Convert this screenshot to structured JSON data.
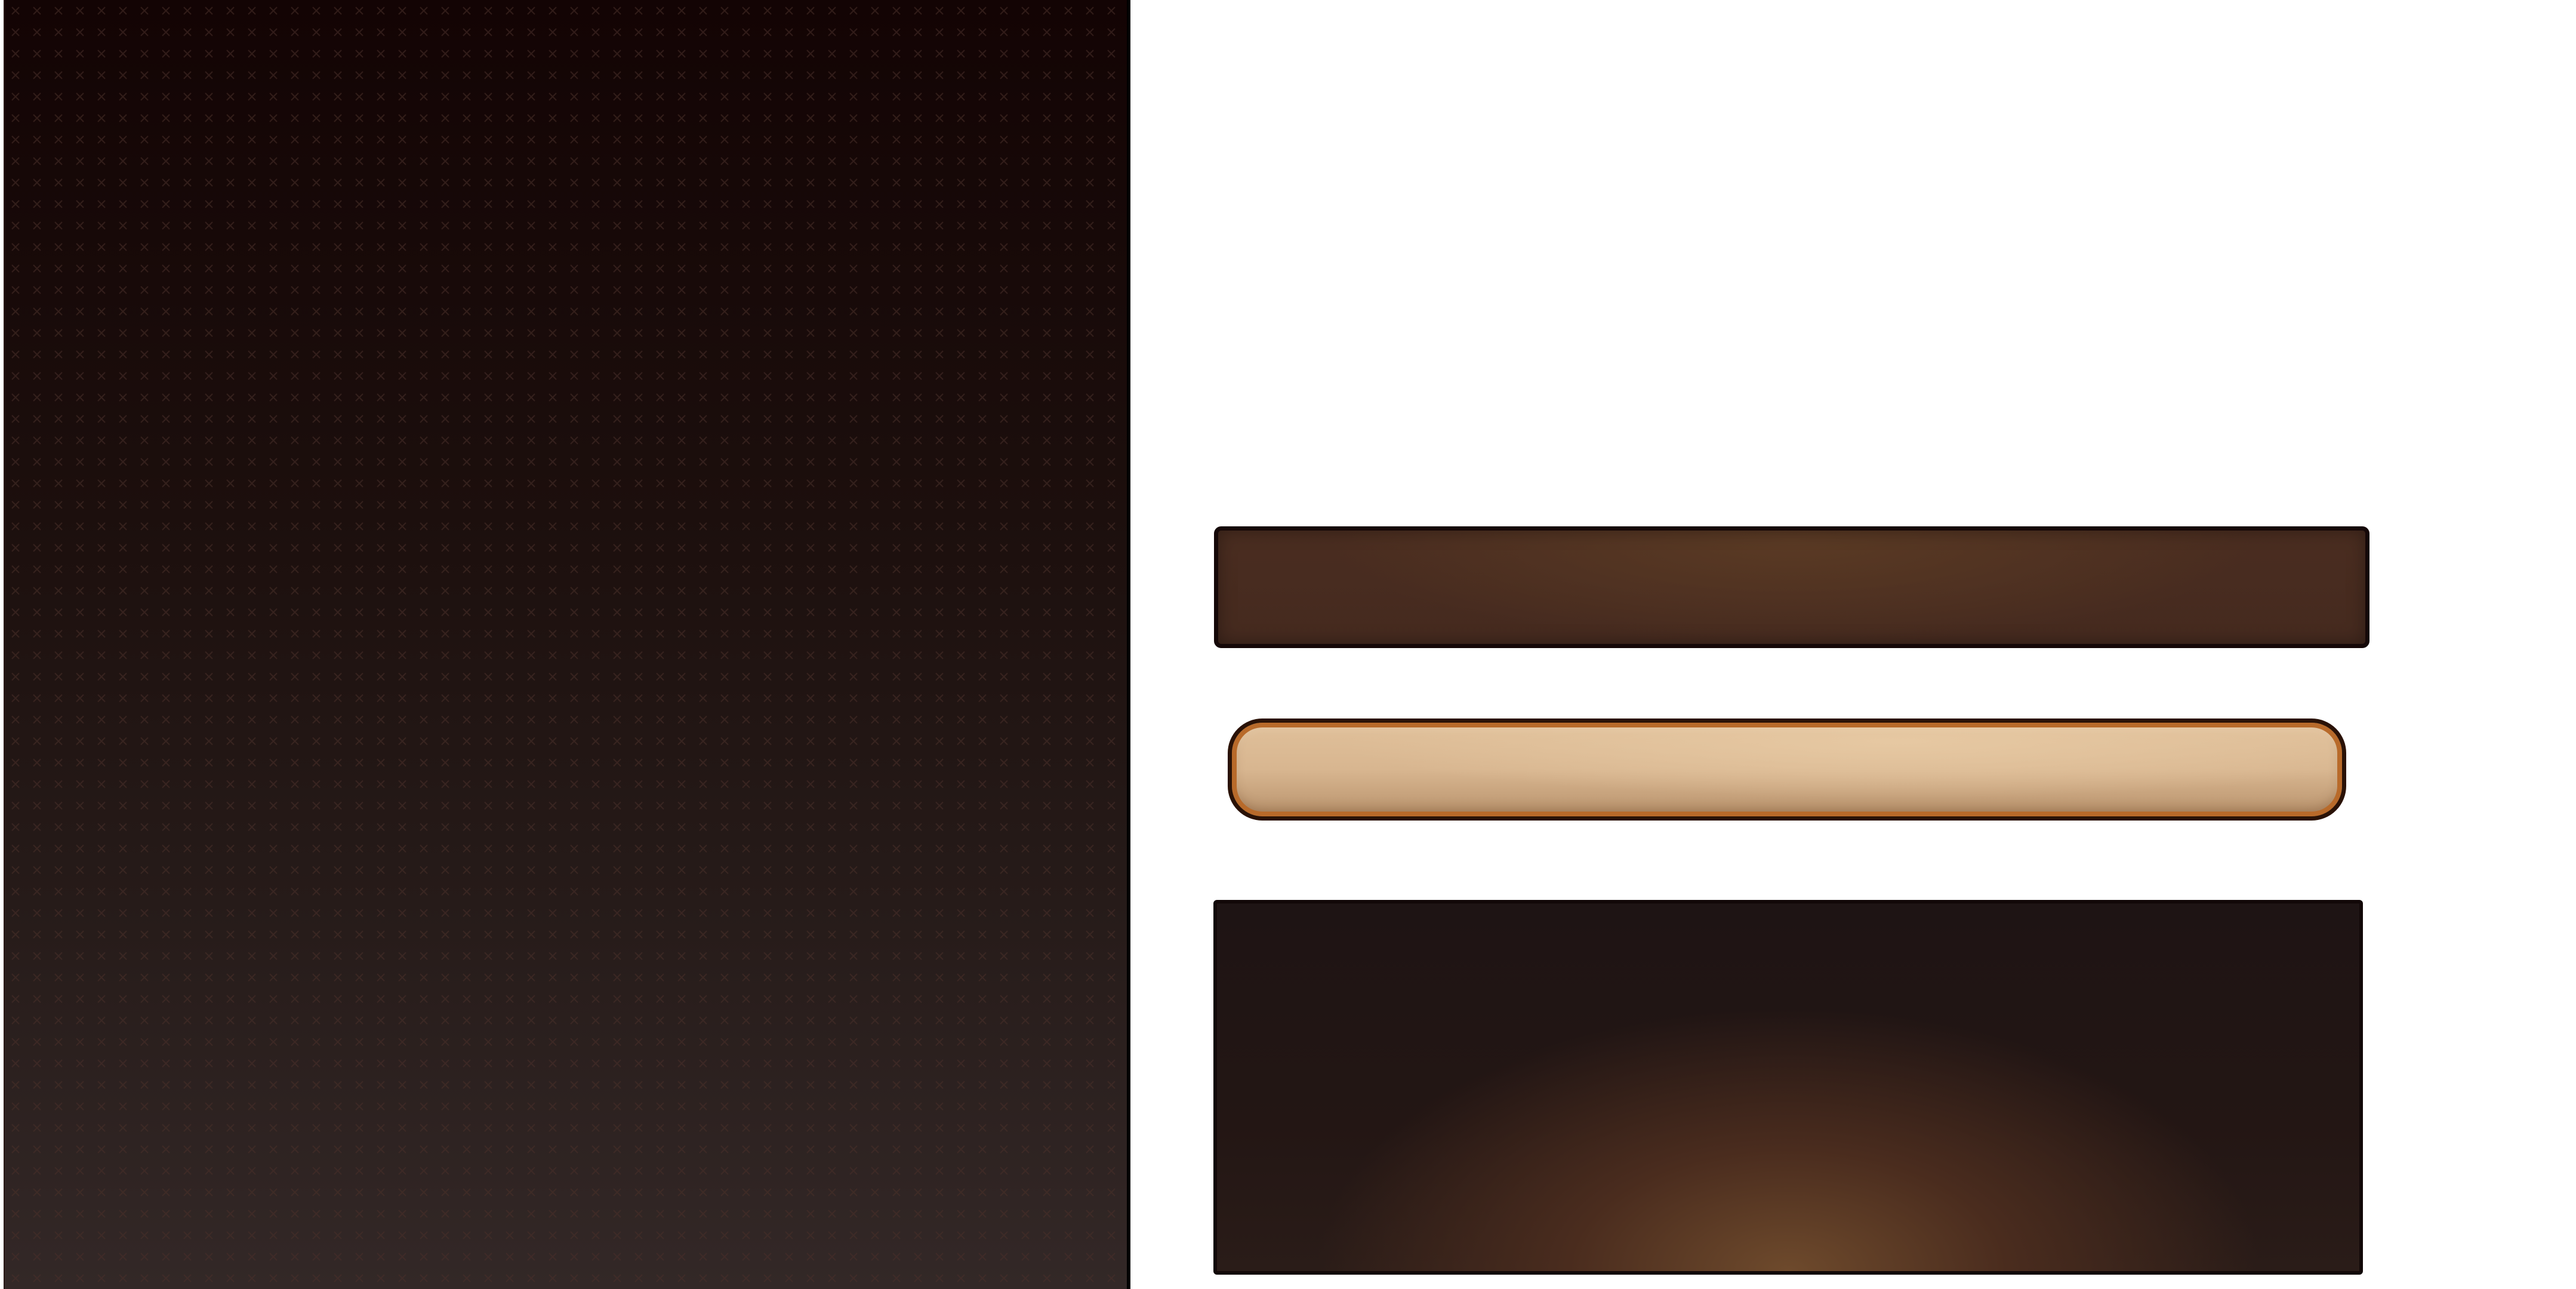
{
  "scene": {
    "description_visible_text": "",
    "elements": [
      {
        "id": "left-panel",
        "kind": "patterned-background-panel",
        "colors": {
          "top": "#130404",
          "bottom": "#332827",
          "pattern": "#3a2622"
        }
      },
      {
        "id": "brown-bar",
        "kind": "banner-bar",
        "colors": {
          "fill": "#4a2d20",
          "highlight": "#5a3a24",
          "border": "#150808"
        }
      },
      {
        "id": "tan-bar",
        "kind": "rounded-input-bar",
        "colors": {
          "fill": "#d8b690",
          "rim": "#b86a2a",
          "border": "#2a1206"
        }
      },
      {
        "id": "dark-panel",
        "kind": "glow-panel",
        "colors": {
          "fill": "#1e1414",
          "glow": "#6e4a2c",
          "border": "#120808"
        }
      }
    ]
  }
}
